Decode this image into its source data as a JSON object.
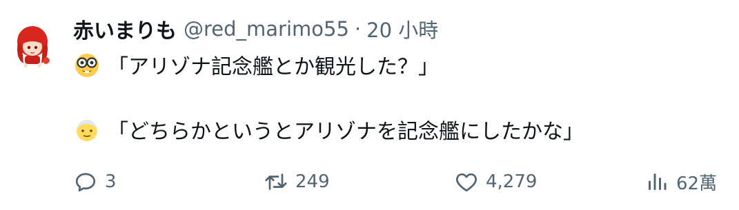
{
  "author": {
    "display_name": "赤いまりも",
    "handle": "@red_marimo55",
    "separator": "·",
    "time": "20 小時",
    "avatar_icon": "red-haired-character-avatar"
  },
  "content": {
    "line1": {
      "emoji": "nerd-face-emoji",
      "text": "「アリゾナ記念艦とか観光した？」"
    },
    "line2": {
      "emoji": "older-person-emoji",
      "text": "「どちらかというとアリゾナを記念艦にしたかな」"
    }
  },
  "actions": {
    "reply": {
      "icon": "reply-icon",
      "count": "3"
    },
    "retweet": {
      "icon": "retweet-icon",
      "count": "249"
    },
    "like": {
      "icon": "heart-icon",
      "count": "4,279"
    },
    "views": {
      "icon": "views-icon",
      "count": "62萬"
    }
  },
  "colors": {
    "text": "#0f1419",
    "secondary": "#536471",
    "background": "#ffffff"
  }
}
